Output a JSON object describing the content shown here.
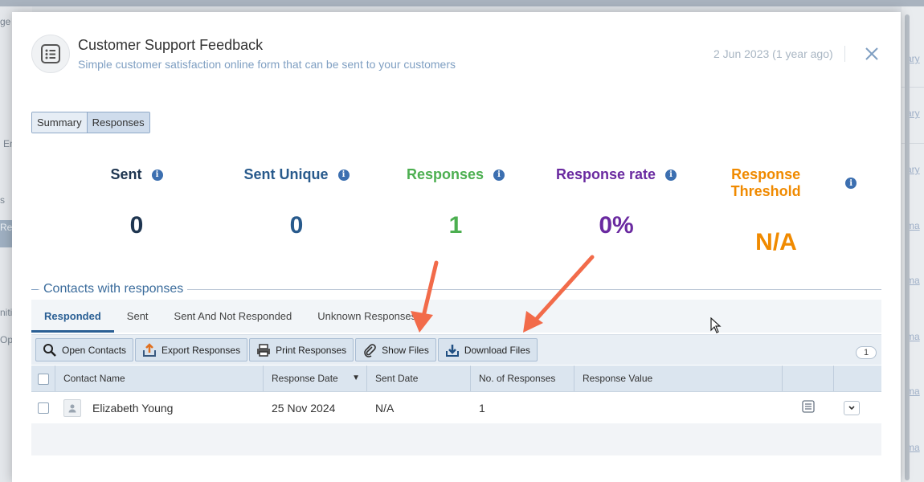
{
  "header": {
    "title": "Customer Support Feedback",
    "subtitle": "Simple customer satisfaction online form that can be sent to your customers",
    "date": "2 Jun 2023 (1 year ago)"
  },
  "view_toggle": {
    "summary": "Summary",
    "responses": "Responses"
  },
  "stats": {
    "sent": {
      "label": "Sent",
      "value": "0"
    },
    "sent_unique": {
      "label": "Sent Unique",
      "value": "0"
    },
    "responses": {
      "label": "Responses",
      "value": "1"
    },
    "response_rate": {
      "label": "Response rate",
      "value": "0%"
    },
    "response_threshold": {
      "label": "Response Threshold",
      "value": "N/A"
    }
  },
  "colors": {
    "sent": "#1e3550",
    "sent_unique": "#285a8c",
    "responses": "#4caf50",
    "response_rate": "#6a2aa0",
    "response_threshold": "#f08a00",
    "annotation_arrow": "#f26b4a"
  },
  "section": {
    "title": "Contacts with responses"
  },
  "tabs": [
    "Responded",
    "Sent",
    "Sent And Not Responded",
    "Unknown Responses"
  ],
  "toolbar": {
    "open_contacts": "Open Contacts",
    "export_responses": "Export Responses",
    "print_responses": "Print Responses",
    "show_files": "Show Files",
    "download_files": "Download Files",
    "count": "1"
  },
  "table": {
    "columns": [
      "Contact Name",
      "Response Date",
      "Sent Date",
      "No. of Responses",
      "Response Value"
    ],
    "sort_indicator": "▼",
    "rows": [
      {
        "contact_name": "Elizabeth Young",
        "response_date": "25 Nov 2024",
        "sent_date": "N/A",
        "responses": "1",
        "response_value": ""
      }
    ]
  },
  "background": {
    "left_fragments": [
      "ge",
      "En",
      "s",
      "Re",
      "niti",
      "Op"
    ],
    "right_fragments": [
      "ary",
      "ary",
      "ary",
      "ma",
      "ma",
      "ma",
      "ma",
      "ma"
    ]
  },
  "icons": {
    "header": "form-list-icon",
    "close": "close-icon",
    "info": "info-icon",
    "open_contacts": "magnifier-icon",
    "export": "export-icon",
    "print": "printer-icon",
    "show_files": "paperclip-icon",
    "download": "download-icon",
    "avatar": "person-icon",
    "view_response": "form-list-icon",
    "row_menu": "chevron-down-icon"
  }
}
